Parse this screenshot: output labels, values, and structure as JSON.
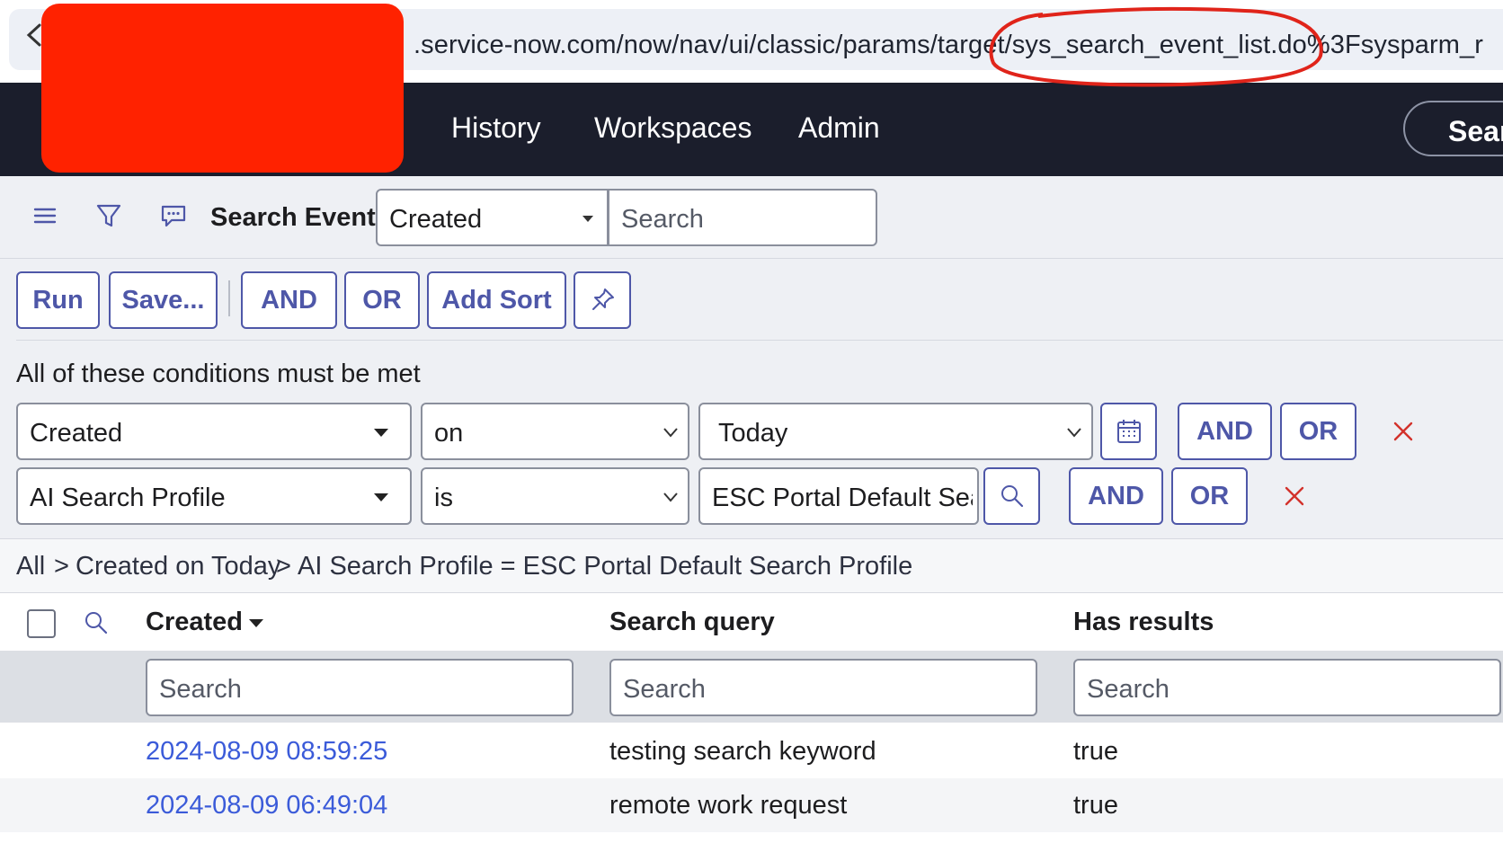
{
  "browser": {
    "url": ".service-now.com/now/nav/ui/classic/params/target/sys_search_event_list.do%3Fsysparm_r"
  },
  "nav": {
    "links": [
      "History",
      "Workspaces",
      "Admin"
    ],
    "search_label": "Sear"
  },
  "list_header": {
    "title": "Search Events",
    "field_select": "Created",
    "search_placeholder": "Search"
  },
  "filter": {
    "buttons": {
      "run": "Run",
      "save": "Save...",
      "and": "AND",
      "or": "OR",
      "add_sort": "Add Sort"
    },
    "condition_label": "All of these conditions must be met",
    "conditions": [
      {
        "field": "Created",
        "operator": "on",
        "value": "Today",
        "and": "AND",
        "or": "OR"
      },
      {
        "field": "AI Search Profile",
        "operator": "is",
        "value": "ESC Portal Default Sear",
        "and": "AND",
        "or": "OR"
      }
    ]
  },
  "breadcrumb": {
    "items": [
      "All",
      "Created on Today",
      "AI Search Profile = ESC Portal Default Search Profile"
    ],
    "separator": ">"
  },
  "table": {
    "columns": [
      "Created",
      "Search query",
      "Has results"
    ],
    "search_placeholder": "Search",
    "rows": [
      {
        "created": "2024-08-09 08:59:25",
        "query": "testing search keyword",
        "has_results": "true"
      },
      {
        "created": "2024-08-09 06:49:04",
        "query": "remote work request",
        "has_results": "true"
      }
    ]
  },
  "colors": {
    "nav_bg": "#1b1e2c",
    "accent": "#4e57a8",
    "link": "#3b5bd9",
    "redaction": "#ff2200",
    "annotation": "#e0241a"
  },
  "icons": [
    "back-arrow-icon",
    "hamburger-menu-icon",
    "filter-icon",
    "comment-icon",
    "caret-down-icon",
    "pin-icon",
    "calendar-icon",
    "search-icon",
    "close-icon",
    "chevron-down-icon"
  ]
}
